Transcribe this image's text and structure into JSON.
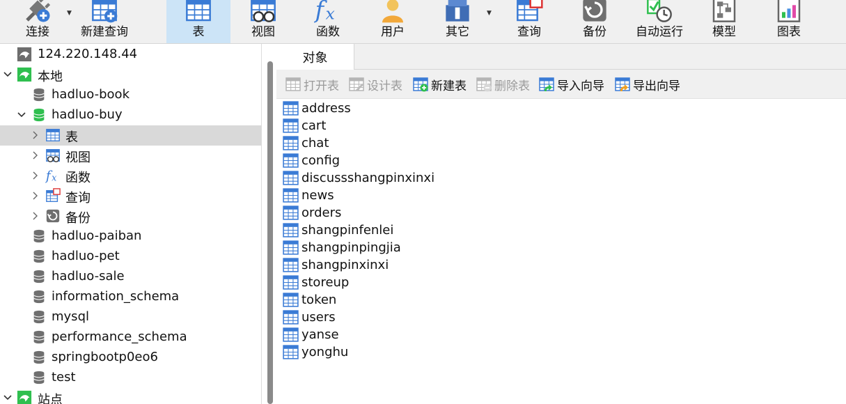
{
  "toolbar": {
    "items": [
      {
        "key": "connect",
        "label": "连接",
        "icon": "connect-plug-icon",
        "has_dropdown": true
      },
      {
        "key": "new_query",
        "label": "新建查询",
        "icon": "new-query-icon"
      },
      {
        "key": "table",
        "label": "表",
        "icon": "table-icon",
        "active": true
      },
      {
        "key": "view",
        "label": "视图",
        "icon": "view-icon"
      },
      {
        "key": "function",
        "label": "函数",
        "icon": "function-icon"
      },
      {
        "key": "user",
        "label": "用户",
        "icon": "user-icon"
      },
      {
        "key": "other",
        "label": "其它",
        "icon": "other-tools-icon",
        "has_dropdown": true
      },
      {
        "key": "query",
        "label": "查询",
        "icon": "query-icon"
      },
      {
        "key": "backup",
        "label": "备份",
        "icon": "backup-icon"
      },
      {
        "key": "auto_run",
        "label": "自动运行",
        "icon": "auto-run-icon"
      },
      {
        "key": "model",
        "label": "模型",
        "icon": "model-icon"
      },
      {
        "key": "chart",
        "label": "图表",
        "icon": "chart-icon"
      }
    ]
  },
  "sidebar": {
    "tree": [
      {
        "label": "124.220.148.44",
        "level": 0,
        "icon": "mysql-connection-icon",
        "expanded": null
      },
      {
        "label": "本地",
        "level": 0,
        "icon": "mysql-connection-icon",
        "expanded": true
      },
      {
        "label": "hadluo-book",
        "level": 1,
        "icon": "database-icon"
      },
      {
        "label": "hadluo-buy",
        "level": 1,
        "icon": "database-icon",
        "expanded": true,
        "active_db": true
      },
      {
        "label": "表",
        "level": 2,
        "icon": "table-icon",
        "expanded": false,
        "selected": true
      },
      {
        "label": "视图",
        "level": 2,
        "icon": "view-icon",
        "expanded": false
      },
      {
        "label": "函数",
        "level": 2,
        "icon": "function-icon",
        "expanded": false
      },
      {
        "label": "查询",
        "level": 2,
        "icon": "query-icon",
        "expanded": false
      },
      {
        "label": "备份",
        "level": 2,
        "icon": "backup-icon",
        "expanded": false
      },
      {
        "label": "hadluo-paiban",
        "level": 1,
        "icon": "database-icon"
      },
      {
        "label": "hadluo-pet",
        "level": 1,
        "icon": "database-icon"
      },
      {
        "label": "hadluo-sale",
        "level": 1,
        "icon": "database-icon"
      },
      {
        "label": "information_schema",
        "level": 1,
        "icon": "database-icon"
      },
      {
        "label": "mysql",
        "level": 1,
        "icon": "database-icon"
      },
      {
        "label": "performance_schema",
        "level": 1,
        "icon": "database-icon"
      },
      {
        "label": "springbootp0eo6",
        "level": 1,
        "icon": "database-icon"
      },
      {
        "label": "test",
        "level": 1,
        "icon": "database-icon"
      },
      {
        "label": "站点",
        "level": 0,
        "icon": "mysql-connection-icon",
        "expanded": true
      }
    ]
  },
  "tabs": [
    {
      "label": "对象"
    }
  ],
  "object_toolbar": {
    "buttons": [
      {
        "label": "打开表",
        "icon": "open-table-icon",
        "disabled": true
      },
      {
        "label": "设计表",
        "icon": "design-table-icon",
        "disabled": true
      },
      {
        "label": "新建表",
        "icon": "new-table-icon",
        "disabled": false
      },
      {
        "label": "删除表",
        "icon": "delete-table-icon",
        "disabled": true
      },
      {
        "label": "导入向导",
        "icon": "import-wizard-icon",
        "disabled": false
      },
      {
        "label": "导出向导",
        "icon": "export-wizard-icon",
        "disabled": false
      }
    ]
  },
  "objects": {
    "tables": [
      "address",
      "cart",
      "chat",
      "config",
      "discussshangpinxinxi",
      "news",
      "orders",
      "shangpinfenlei",
      "shangpinpingjia",
      "shangpinxinxi",
      "storeup",
      "token",
      "users",
      "yanse",
      "yonghu"
    ]
  },
  "colors": {
    "accent_blue": "#3a7bd5",
    "active_tab_bg": "#cce4f7",
    "mysql_green": "#2fbf4f",
    "selected_row_bg": "#d9d9d9",
    "toolbar_bg": "#f0f0f0"
  }
}
